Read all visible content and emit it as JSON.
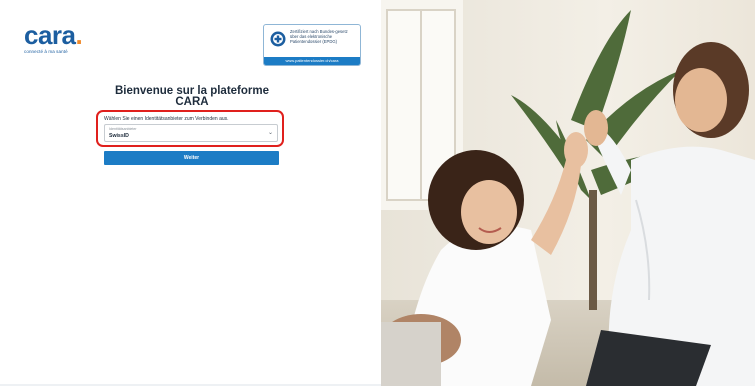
{
  "brand": {
    "name": "cara",
    "dot": ".",
    "tagline": "connecté à ma santé"
  },
  "badge": {
    "text": "Zertifiziert nach Bundes-gesetz über das elektronische Patientendossier (EPDG)",
    "link": "www.patientendossier.ch/cara"
  },
  "login": {
    "title": "Bienvenue sur la plateforme CARA",
    "prompt": "Wählen Sie einen Identitätsanbieter zum Verbinden aus.",
    "select_label": "Identitätsanbieter",
    "select_value": "SwissID",
    "submit_label": "Weiter"
  },
  "colors": {
    "brand_blue": "#1c5ea0",
    "accent_orange": "#f08a2a",
    "button_blue": "#1c7cc5",
    "highlight_red": "#e0201d"
  },
  "icons": {
    "badge": "medical-cross-icon",
    "select": "chevron-down-icon"
  }
}
